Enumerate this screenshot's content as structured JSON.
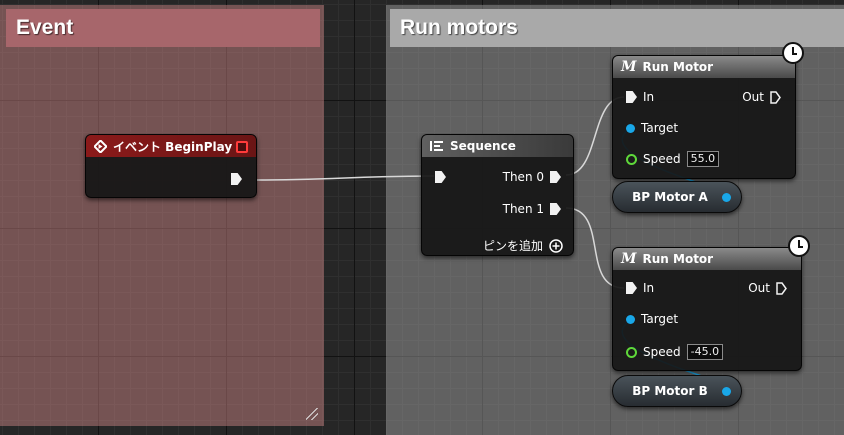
{
  "comments": {
    "event": {
      "title": "Event"
    },
    "run": {
      "title": "Run motors"
    }
  },
  "begin_play": {
    "title": "イベント BeginPlay"
  },
  "sequence": {
    "title": "Sequence",
    "then0": "Then 0",
    "then1": "Then 1",
    "add_pin": "ピンを追加"
  },
  "run_motor_a": {
    "title": "Run Motor",
    "in": "In",
    "out": "Out",
    "target": "Target",
    "speed_label": "Speed",
    "speed_value": "55.0"
  },
  "run_motor_b": {
    "title": "Run Motor",
    "in": "In",
    "out": "Out",
    "target": "Target",
    "speed_label": "Speed",
    "speed_value": "-45.0"
  },
  "var_a": {
    "label": "BP Motor A"
  },
  "var_b": {
    "label": "BP Motor B"
  },
  "colors": {
    "event_header": "#8b1a1a",
    "function_header": "#5c5c5c",
    "object_pin": "#19a7e8",
    "float_pin": "#5fd83a"
  },
  "icons": [
    "diamond-event-icon",
    "sequence-icon",
    "function-m-icon",
    "latent-clock-icon",
    "add-pin-icon"
  ]
}
